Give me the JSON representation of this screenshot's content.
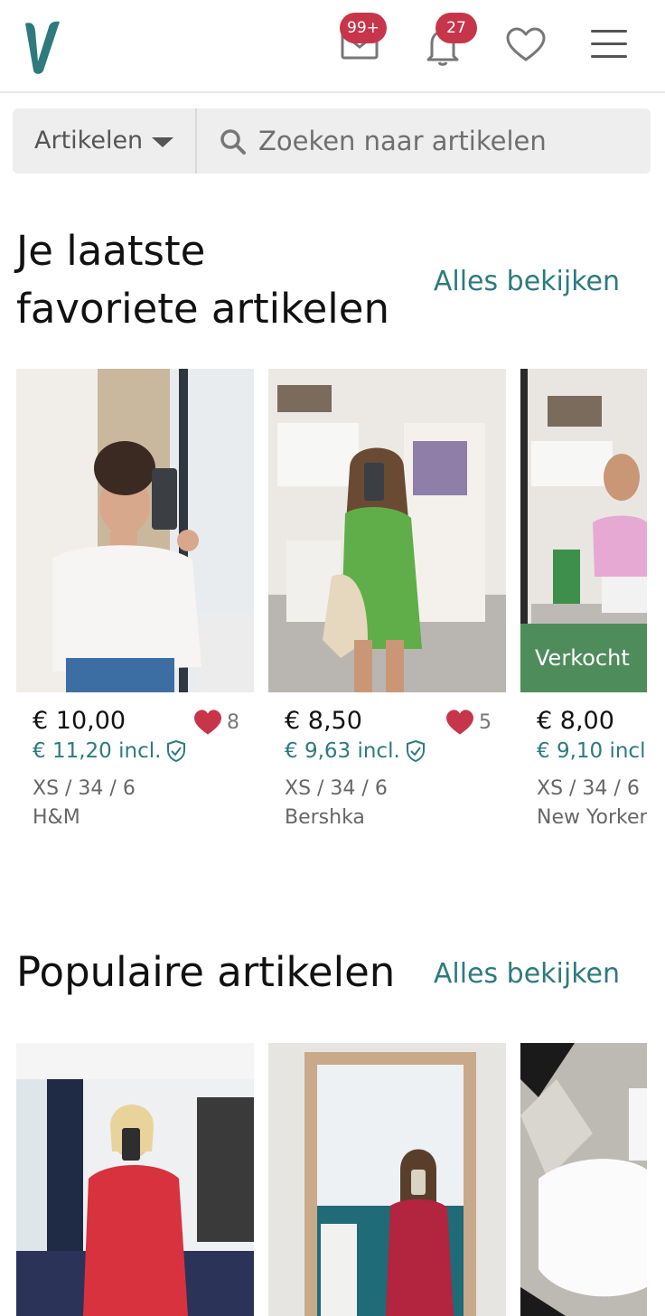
{
  "header": {
    "inbox_badge": "99+",
    "notifications_badge": "27",
    "logo_icon": "vinted-v-logo",
    "brand_color": "#2e7a7d",
    "badge_color": "#c7354b"
  },
  "search": {
    "category_label": "Artikelen",
    "placeholder": "Zoeken naar artikelen"
  },
  "favorites_section": {
    "title_line1": "Je laatste",
    "title_line2": "favoriete artikelen",
    "see_all": "Alles bekijken",
    "items": [
      {
        "price": "€ 10,00",
        "favorites": "8",
        "price_incl": "€ 11,20 incl.",
        "size": "XS / 34 / 6",
        "brand": "H&M",
        "sold_label": ""
      },
      {
        "price": "€ 8,50",
        "favorites": "5",
        "price_incl": "€ 9,63 incl.",
        "size": "XS / 34 / 6",
        "brand": "Bershka",
        "sold_label": ""
      },
      {
        "price": "€ 8,00",
        "favorites": "",
        "price_incl": "€ 9,10 incl.",
        "size": "XS / 34 / 6",
        "brand": "New Yorker",
        "sold_label": "Verkocht"
      }
    ]
  },
  "popular_section": {
    "title": "Populaire artikelen",
    "see_all": "Alles bekijken"
  }
}
